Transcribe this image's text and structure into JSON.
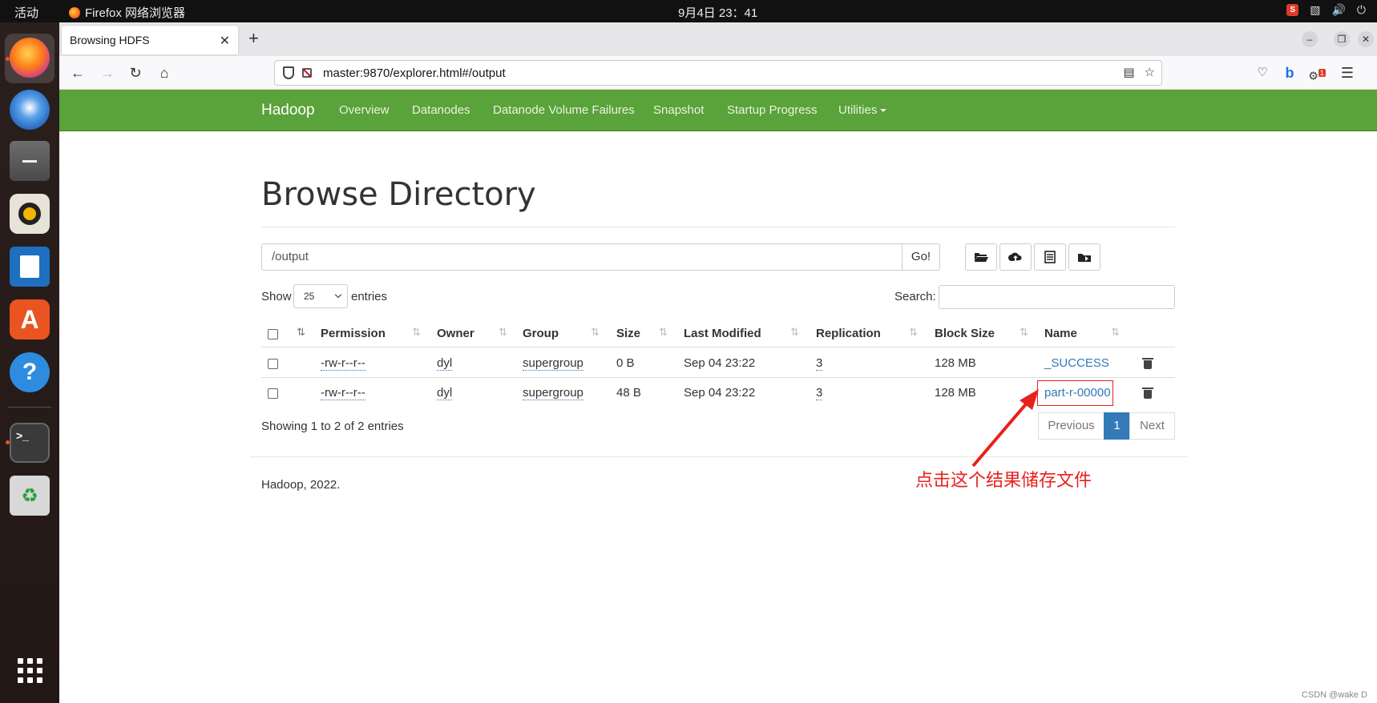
{
  "topbar": {
    "activities": "活动",
    "app_name": "Firefox 网络浏览器",
    "clock": "9月4日  23：41"
  },
  "browser": {
    "tab_title": "Browsing HDFS",
    "url": "master:9870/explorer.html#/output",
    "account_badge": "1"
  },
  "hadoop_nav": {
    "brand": "Hadoop",
    "items": [
      "Overview",
      "Datanodes",
      "Datanode Volume Failures",
      "Snapshot",
      "Startup Progress",
      "Utilities"
    ]
  },
  "main": {
    "title": "Browse Directory",
    "path_value": "/output",
    "go_label": "Go!",
    "show_label": "Show",
    "entries_select": "25",
    "entries_label": "entries",
    "search_label": "Search:",
    "columns": [
      "Permission",
      "Owner",
      "Group",
      "Size",
      "Last Modified",
      "Replication",
      "Block Size",
      "Name"
    ],
    "rows": [
      {
        "permission": "-rw-r--r--",
        "owner": "dyl",
        "group": "supergroup",
        "size": "0 B",
        "modified": "Sep 04 23:22",
        "replication": "3",
        "block_size": "128 MB",
        "name": "_SUCCESS"
      },
      {
        "permission": "-rw-r--r--",
        "owner": "dyl",
        "group": "supergroup",
        "size": "48 B",
        "modified": "Sep 04 23:22",
        "replication": "3",
        "block_size": "128 MB",
        "name": "part-r-00000"
      }
    ],
    "showing_text": "Showing 1 to 2 of 2 entries",
    "pagination": {
      "previous": "Previous",
      "current": "1",
      "next": "Next"
    },
    "footer": "Hadoop, 2022."
  },
  "annotation": {
    "text": "点击这个结果储存文件",
    "color": "#e8201c"
  },
  "watermark": "CSDN @wake D",
  "colors": {
    "navbar_green": "#5aa23a",
    "link_blue": "#337ab7",
    "topbar": "#111111"
  }
}
